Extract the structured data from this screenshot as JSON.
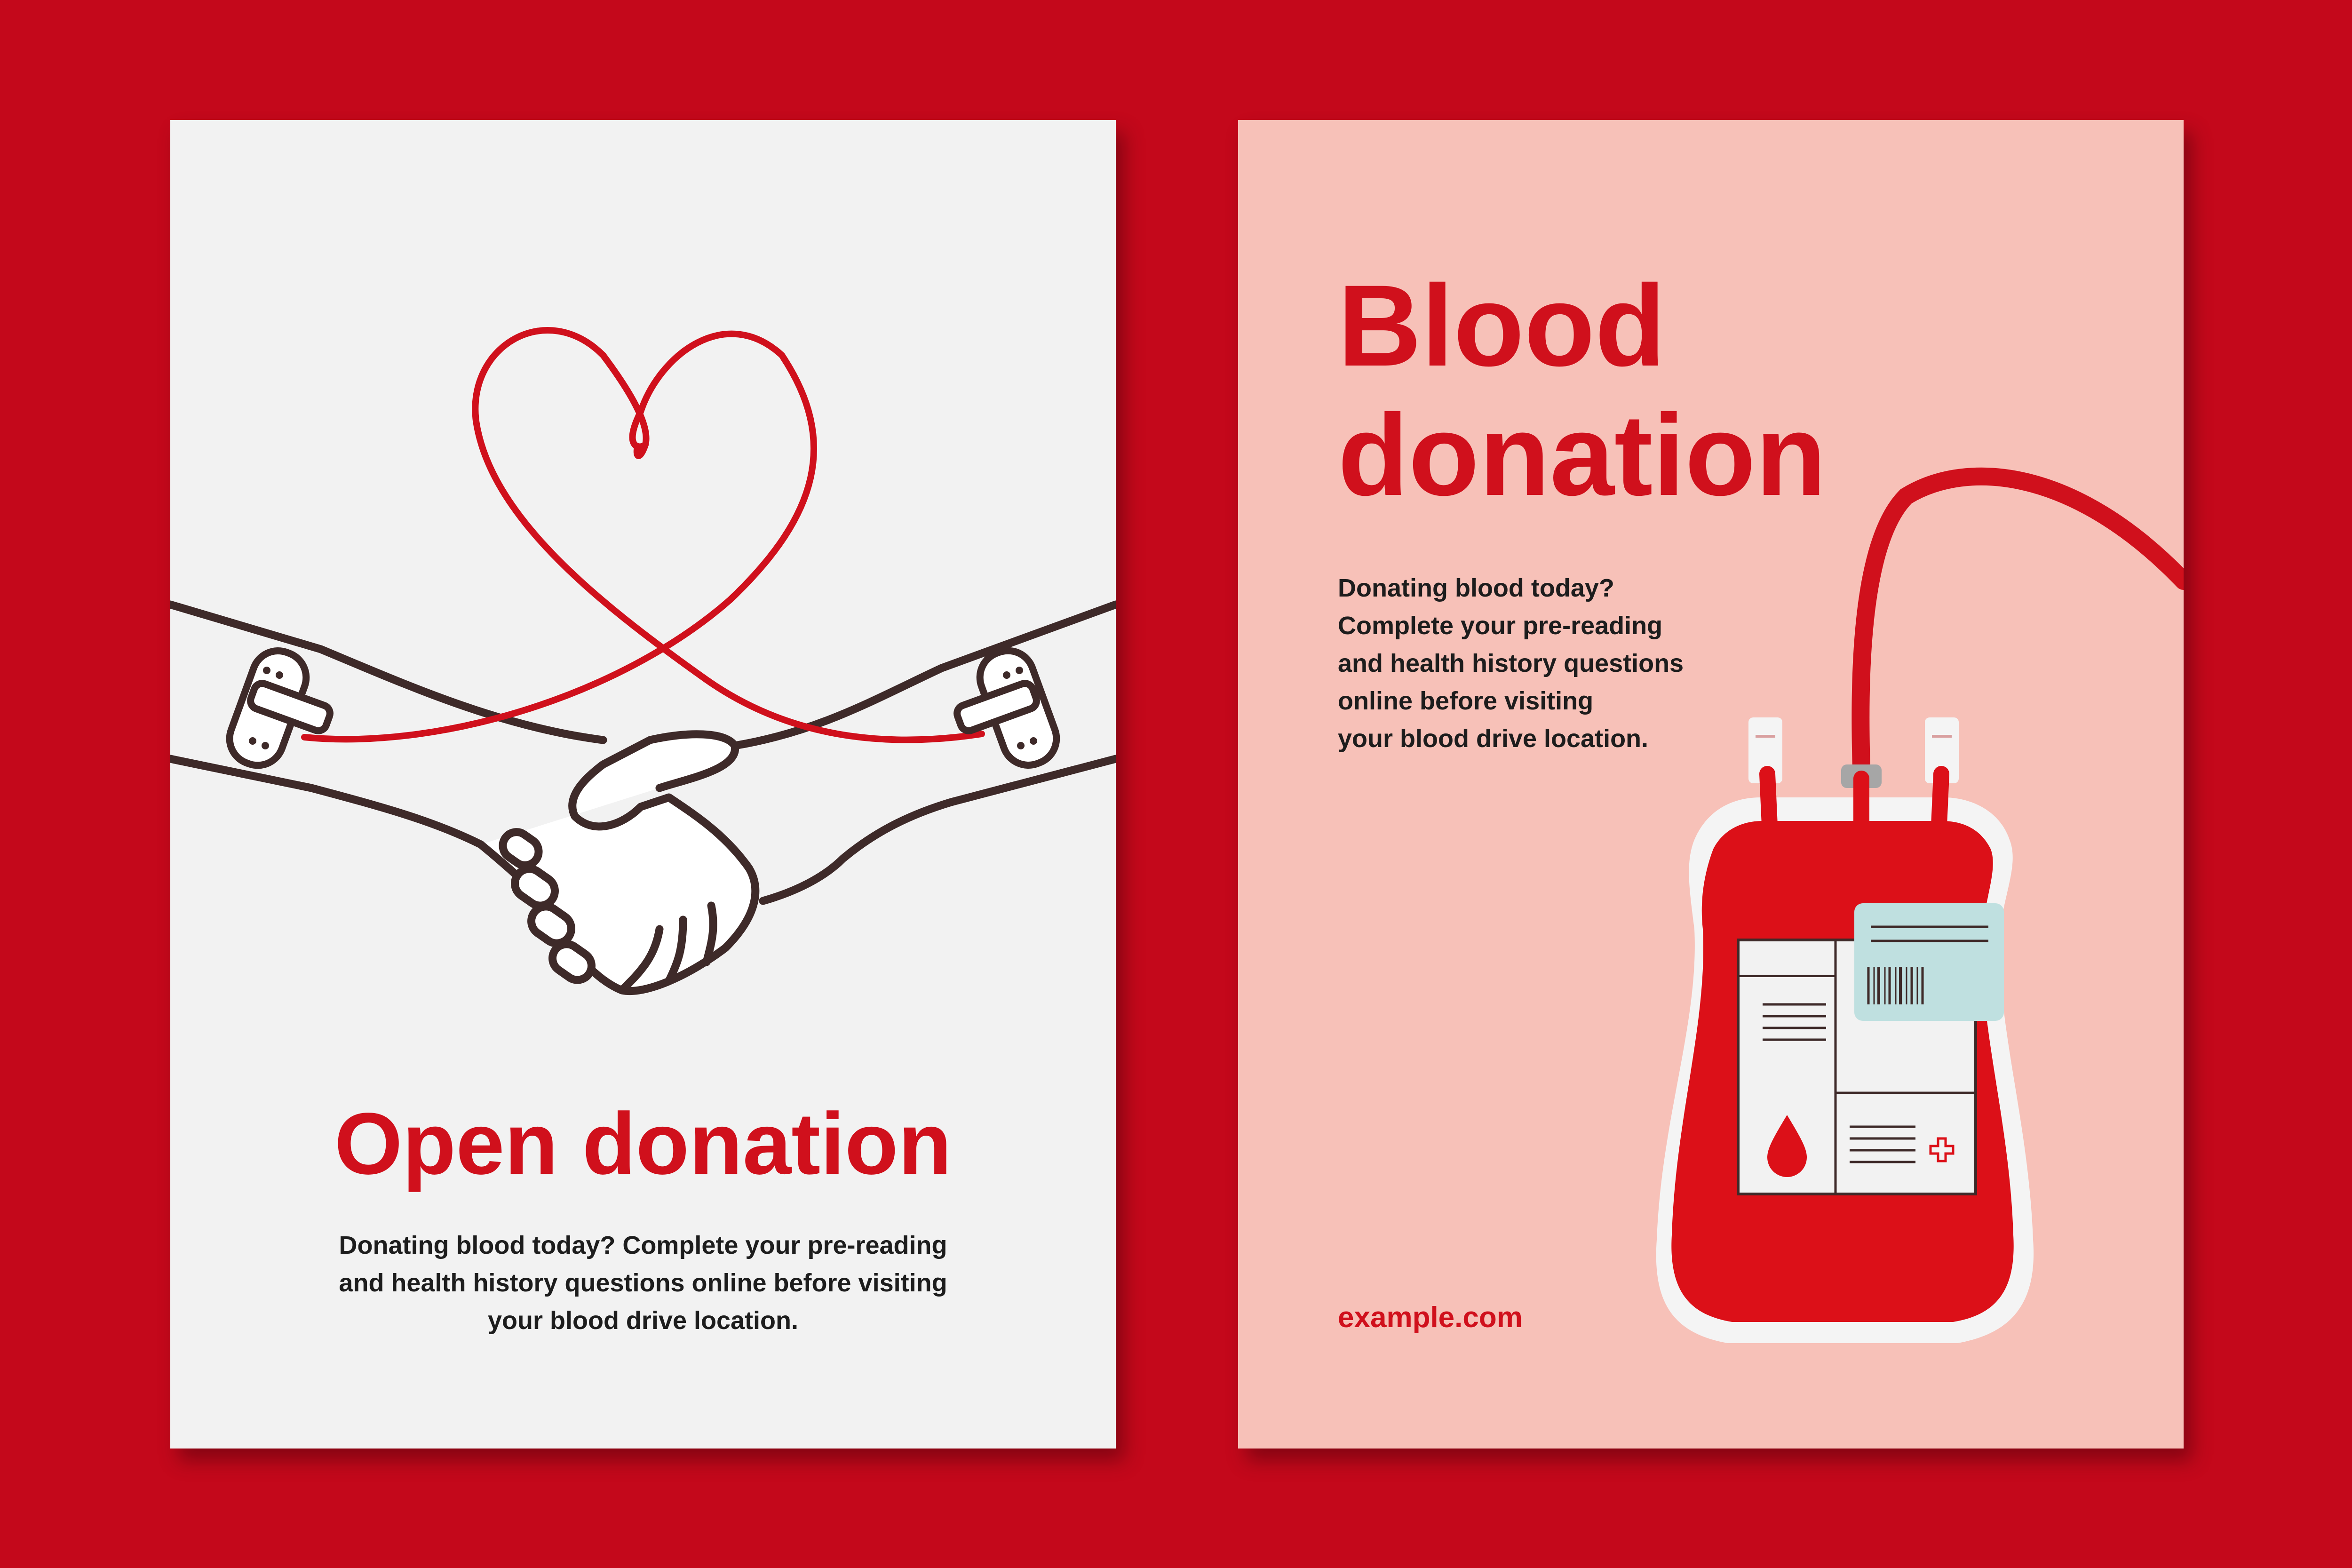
{
  "colors": {
    "background": "#c4081b",
    "accent_red": "#d0101c",
    "poster_left_bg": "#f2f2f2",
    "poster_right_bg": "#f7c1b8",
    "outline_brown": "#3e2a29",
    "label_mint": "#bfe0e0"
  },
  "poster_left": {
    "title": "Open donation",
    "body_lines": [
      "Donating blood today? Complete your pre-reading",
      "and health history questions online before visiting",
      "your blood drive location."
    ],
    "illustration": "handshake-heart-tube-icon"
  },
  "poster_right": {
    "title_lines": [
      "Blood",
      "donation"
    ],
    "body_lines": [
      "Donating blood today?",
      "Complete your pre-reading",
      "and health history questions",
      "online before visiting",
      "your blood drive location."
    ],
    "url": "example.com",
    "illustration": "blood-bag-icon"
  }
}
